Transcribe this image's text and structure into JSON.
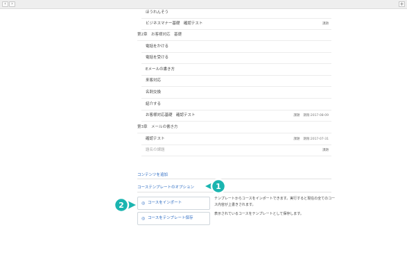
{
  "browser": {
    "back_label": "‹",
    "forward_label": "›",
    "new_tab_label": "+"
  },
  "rows": [
    {
      "label": "ほうれんそう",
      "tag": "",
      "date": ""
    },
    {
      "label": "ビジネスマナー基礎　確認テスト",
      "tag": "課題",
      "date": ""
    },
    {
      "label": "第2章　お客様対応　基礎",
      "tag": "",
      "date": ""
    },
    {
      "label": "電話をかける",
      "tag": "",
      "date": ""
    },
    {
      "label": "電話を受ける",
      "tag": "",
      "date": ""
    },
    {
      "label": "Eメールの書き方",
      "tag": "",
      "date": ""
    },
    {
      "label": "来客対応",
      "tag": "",
      "date": ""
    },
    {
      "label": "名刺交換",
      "tag": "",
      "date": ""
    },
    {
      "label": "紹介する",
      "tag": "",
      "date": ""
    },
    {
      "label": "お客様対応基礎　確認テスト",
      "tag": "課題",
      "date": "期限:2017-08-09"
    },
    {
      "label": "第3章　メールの書き方",
      "tag": "",
      "date": ""
    },
    {
      "label": "確認テスト",
      "tag": "課題",
      "date": "期限:2017-07-31"
    },
    {
      "label": "題名の課題",
      "tag": "課題",
      "date": ""
    }
  ],
  "add_content_link": "コンテンツを追加",
  "template_options_link": "コーステンプレートのオプション",
  "options": [
    {
      "label": "コースをインポート",
      "icon": "circle-icon",
      "desc": "テンプレートからコースをインポートできます。実行すると現在の全てのコース内容が上書きされます。"
    },
    {
      "label": "コースをテンプレート保存",
      "icon": "circle-icon",
      "desc": "表示されているコースをテンプレートとして保存します。"
    }
  ],
  "callouts": [
    {
      "number": "1"
    },
    {
      "number": "2"
    }
  ],
  "colors": {
    "callout": "#1bb5b0",
    "link": "#2a6ac2"
  }
}
